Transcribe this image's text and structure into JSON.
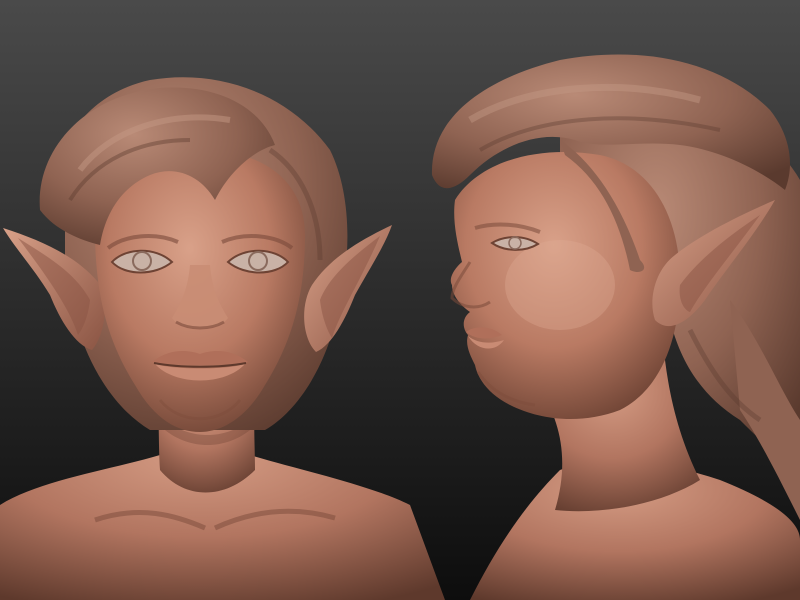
{
  "palette": {
    "background_top": "#4a4a4a",
    "background_bottom": "#0d0d0d",
    "clay_light": "#d9a189",
    "clay_mid": "#b97a63",
    "clay_dark": "#6e4334",
    "hair_light": "#b98a76",
    "hair_mid": "#8f6352",
    "hair_dark": "#5a3a2e",
    "eye": "#c9b2a6"
  },
  "views": [
    {
      "name": "front-view",
      "subject": "elf-bust-front"
    },
    {
      "name": "side-view",
      "subject": "elf-bust-three-quarter"
    }
  ]
}
